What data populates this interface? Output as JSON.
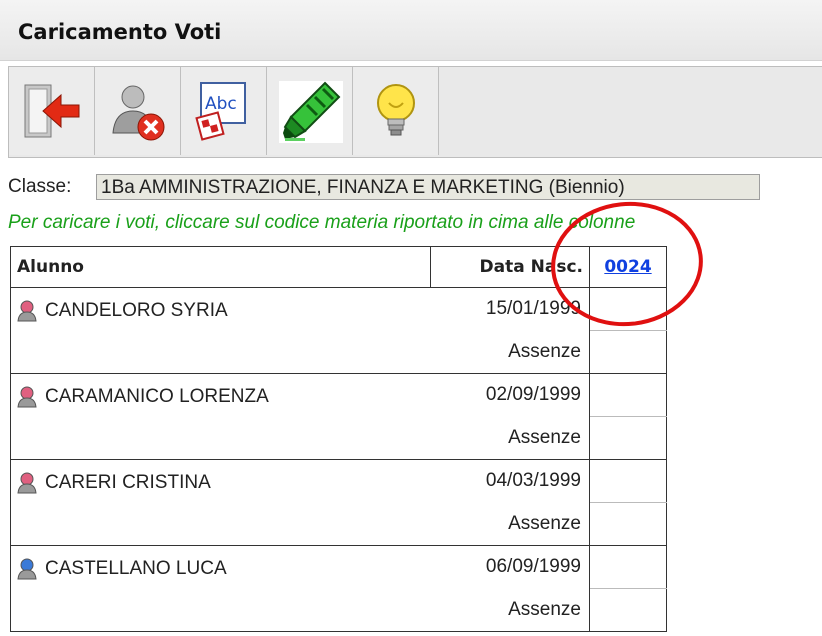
{
  "window": {
    "title": "Caricamento Voti"
  },
  "toolbar": {
    "buttons": [
      {
        "icon": "exit-door-icon"
      },
      {
        "icon": "delete-user-icon"
      },
      {
        "icon": "spellcheck-icon"
      },
      {
        "icon": "highlighter-icon"
      },
      {
        "icon": "lightbulb-icon"
      }
    ]
  },
  "class_row": {
    "label": "Classe:",
    "value": "1Ba AMMINISTRAZIONE, FINANZA E MARKETING (Biennio)"
  },
  "hint": "Per caricare i voti, cliccare sul codice materia riportato in cima alle colonne",
  "table": {
    "headers": {
      "student": "Alunno",
      "birth_date": "Data Nasc.",
      "subject_code": "0024"
    },
    "absence_label": "Assenze",
    "rows": [
      {
        "name": "CANDELORO SYRIA",
        "birth_date": "15/01/1999",
        "gender": "female"
      },
      {
        "name": "CARAMANICO LORENZA",
        "birth_date": "02/09/1999",
        "gender": "female"
      },
      {
        "name": "CARERI CRISTINA",
        "birth_date": "04/03/1999",
        "gender": "female"
      },
      {
        "name": "CASTELLANO LUCA",
        "birth_date": "06/09/1999",
        "gender": "male"
      }
    ]
  },
  "colors": {
    "hint_text": "#1aa01a",
    "link": "#1040e0",
    "annotation_circle": "#e01010",
    "female_icon": "#e06080",
    "male_icon": "#3a7ad8"
  }
}
